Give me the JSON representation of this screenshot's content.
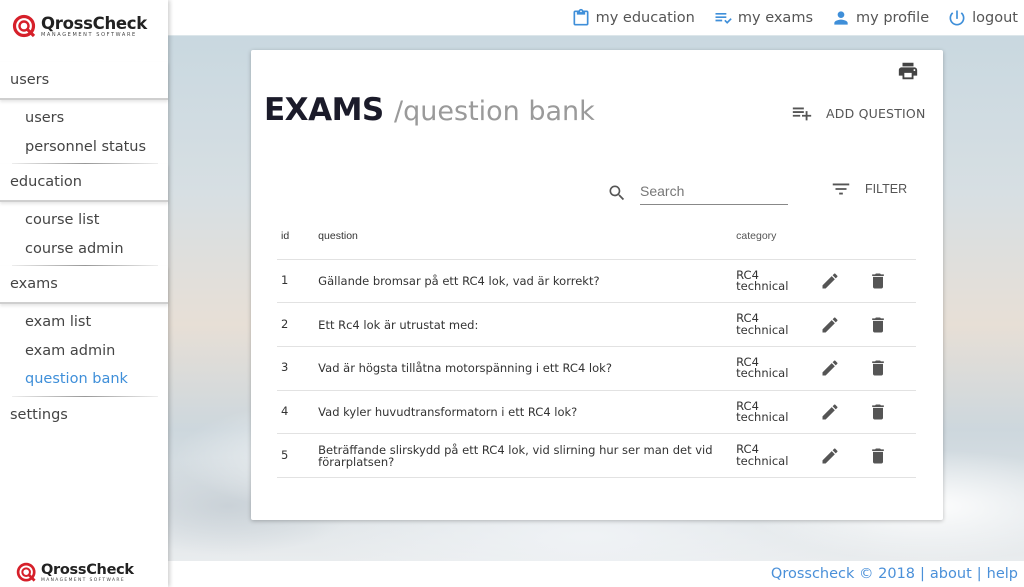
{
  "brand": {
    "name": "QrossCheck",
    "tagline": "MANAGEMENT SOFTWARE",
    "accent_color": "#d6202a"
  },
  "topnav": {
    "items": [
      {
        "label": "my education",
        "icon": "clipboard-icon"
      },
      {
        "label": "my exams",
        "icon": "checklist-icon"
      },
      {
        "label": "my profile",
        "icon": "person-icon"
      },
      {
        "label": "logout",
        "icon": "power-icon"
      }
    ],
    "icon_color": "#3f8fd9"
  },
  "sidebar": {
    "sections": [
      {
        "label": "users",
        "items": [
          {
            "label": "users"
          },
          {
            "label": "personnel status"
          }
        ]
      },
      {
        "label": "education",
        "items": [
          {
            "label": "course list"
          },
          {
            "label": "course admin"
          }
        ]
      },
      {
        "label": "exams",
        "items": [
          {
            "label": "exam list"
          },
          {
            "label": "exam admin"
          },
          {
            "label": "question bank",
            "active": true
          }
        ]
      },
      {
        "label": "settings",
        "items": []
      }
    ],
    "active_color": "#3f8fd9"
  },
  "page": {
    "title": "EXAMS",
    "subtitle": "/question bank",
    "add_question_label": "ADD QUESTION",
    "filter_label": "FILTER",
    "search": {
      "placeholder": "Search",
      "value": ""
    }
  },
  "table": {
    "headers": {
      "id": "id",
      "question": "question",
      "category": "category"
    },
    "rows": [
      {
        "id": "1",
        "question": "Gällande bromsar på ett RC4 lok, vad är korrekt?",
        "category_line1": "RC4",
        "category_line2": "technical"
      },
      {
        "id": "2",
        "question": "Ett Rc4 lok är utrustat med:",
        "category_line1": "RC4",
        "category_line2": "technical"
      },
      {
        "id": "3",
        "question": "Vad är högsta tillåtna motorspänning i ett RC4 lok?",
        "category_line1": "RC4",
        "category_line2": "technical"
      },
      {
        "id": "4",
        "question": "Vad kyler huvudtransformatorn i ett RC4 lok?",
        "category_line1": "RC4",
        "category_line2": "technical"
      },
      {
        "id": "5",
        "question": "Beträffande slirskydd på ett RC4 lok, vid slirning hur ser man det vid förarplatsen?",
        "category_line1": "RC4",
        "category_line2": "technical"
      }
    ]
  },
  "footer": {
    "copyright": "Qrosscheck © 2018",
    "separator": "|",
    "about": "about",
    "help": "help"
  }
}
